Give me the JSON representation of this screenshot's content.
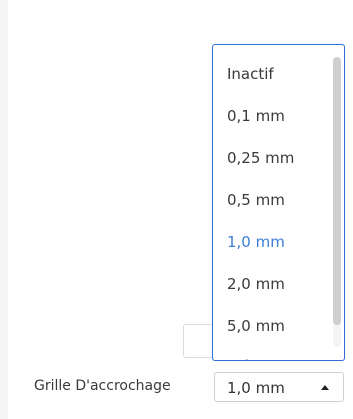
{
  "field": {
    "label": "Grille D'accrochage",
    "value": "1,0 mm"
  },
  "dropdown": {
    "options": [
      {
        "label": "Inactif",
        "selected": false
      },
      {
        "label": "0,1 mm",
        "selected": false
      },
      {
        "label": "0,25 mm",
        "selected": false
      },
      {
        "label": "0,5 mm",
        "selected": false
      },
      {
        "label": "1,0 mm",
        "selected": true
      },
      {
        "label": "2,0 mm",
        "selected": false
      },
      {
        "label": "5,0 mm",
        "selected": false
      },
      {
        "label": "Point",
        "selected": false
      }
    ]
  },
  "colors": {
    "accent": "#2f6fd6",
    "selected_text": "#3d7fd8"
  }
}
